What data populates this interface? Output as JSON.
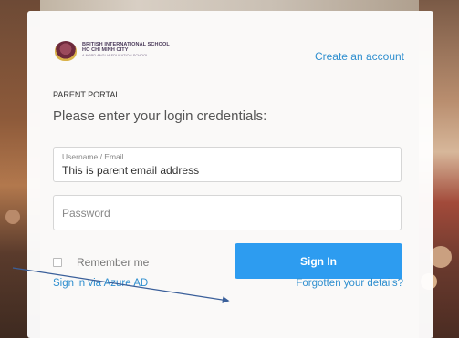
{
  "school": {
    "name_line1": "BRITISH INTERNATIONAL SCHOOL",
    "name_line2": "HO CHI MINH CITY",
    "tagline": "A NORD ANGLIA EDUCATION SCHOOL"
  },
  "header": {
    "create_account": "Create an account"
  },
  "portal": {
    "label": "PARENT PORTAL",
    "heading": "Please enter your login credentials:"
  },
  "form": {
    "username_label": "Username / Email",
    "username_value": "This is parent email address",
    "password_placeholder": "Password",
    "remember_label": "Remember me",
    "signin_label": "Sign In"
  },
  "links": {
    "azure": "Sign in via Azure AD",
    "forgot": "Forgotten your details?"
  },
  "colors": {
    "accent": "#2d9cf0",
    "link": "#2f8fcf",
    "arrow": "#3a5f9a"
  },
  "icons": {
    "logo": "school-crest-icon",
    "checkbox": "checkbox-icon",
    "arrow": "annotation-arrow-icon"
  }
}
